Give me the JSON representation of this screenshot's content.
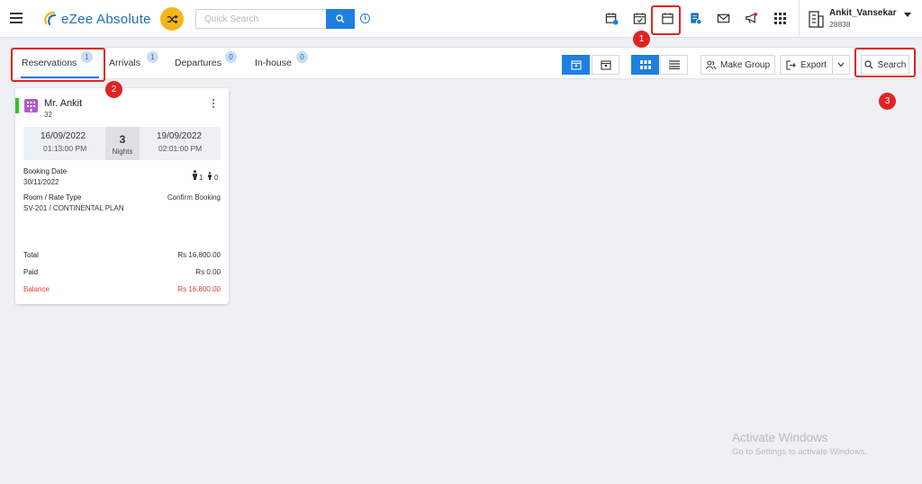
{
  "app": {
    "name": "eZee Absolute"
  },
  "search": {
    "placeholder": "Quick Search"
  },
  "user": {
    "name": "Ankit_Vansekar",
    "id": "28838"
  },
  "tabs": [
    {
      "label": "Reservations",
      "count": "1",
      "active": true
    },
    {
      "label": "Arrivals",
      "count": "1"
    },
    {
      "label": "Departures",
      "count": "0"
    },
    {
      "label": "In-house",
      "count": "0"
    }
  ],
  "toolbar": {
    "make_group": "Make Group",
    "export": "Export",
    "search": "Search"
  },
  "annotations": [
    "1",
    "2",
    "3"
  ],
  "reservation": {
    "guest_name": "Mr. Ankit",
    "guest_sub": "32",
    "checkin_date": "16/09/2022",
    "checkin_time": "01:13:00 PM",
    "nights": "3",
    "nights_label": "Nights",
    "checkout_date": "19/09/2022",
    "checkout_time": "02:01:00 PM",
    "booking_date_label": "Booking Date",
    "booking_date": "30/11/2022",
    "adults": "1",
    "children": "0",
    "room_rate_label": "Room / Rate Type",
    "room_rate": "SV-201 / CONTINENTAL PLAN",
    "booking_status": "Confirm Booking",
    "total_label": "Total",
    "total": "Rs 16,800.00",
    "paid_label": "Paid",
    "paid": "Rs 0.00",
    "balance_label": "Balance",
    "balance": "Rs 16,800.00"
  },
  "watermark": {
    "line1": "Activate Windows",
    "line2": "Go to Settings to activate Windows."
  },
  "colors": {
    "accent": "#1e7fe0",
    "highlight": "#e02424",
    "status_confirmed": "#33c32a",
    "balance": "#e53935"
  }
}
